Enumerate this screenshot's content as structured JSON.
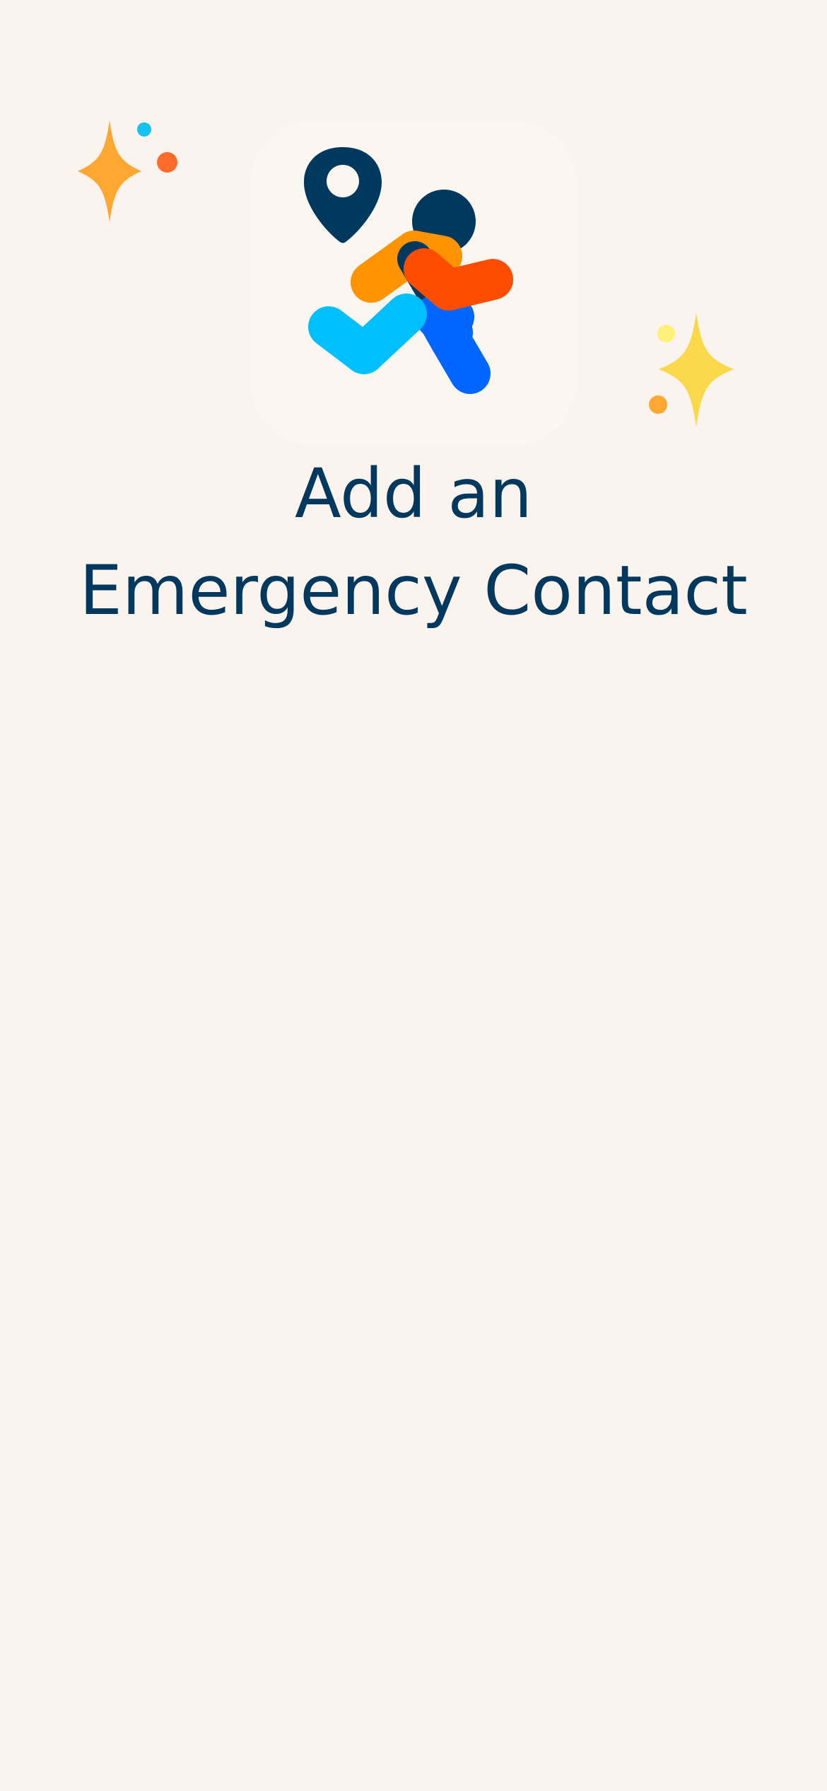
{
  "title": {
    "line1": "Add an",
    "line2": "Emergency Contact"
  },
  "logo": {
    "icon": "emergency-contact-app-icon",
    "pin_icon": "location-pin-icon",
    "person_icon": "person-icon",
    "check_icon": "checkmark-icon"
  },
  "decorations": {
    "left_sparkle": "sparkle-icon",
    "right_sparkle": "sparkle-icon"
  },
  "colors": {
    "background": "#FBF4EE",
    "title": "#00385E",
    "navy": "#00385E",
    "orange": "#FF9300",
    "red_orange": "#FF4D00",
    "cyan": "#00BFFF",
    "blue": "#0066FF",
    "sparkle_orange": "#FFA733",
    "sparkle_yellow": "#F9D84A",
    "dot_cyan": "#17C1F0",
    "dot_orange": "#FF6B28",
    "dot_yellow": "#FFF07A"
  }
}
